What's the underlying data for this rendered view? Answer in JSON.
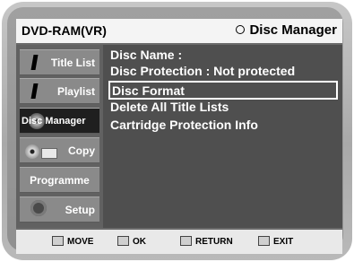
{
  "header": {
    "mode": "DVD-RAM(VR)",
    "title": "Disc Manager"
  },
  "sidebar": {
    "items": [
      {
        "label": "Title List",
        "icon": "disc-icon"
      },
      {
        "label": "Playlist",
        "icon": "disc-icon"
      },
      {
        "label": "Disc Manager",
        "icon": "disc-icon"
      },
      {
        "label": "Copy",
        "icon": "copy-icon"
      },
      {
        "label": "Programme",
        "icon": ""
      },
      {
        "label": "Setup",
        "icon": "gear-icon"
      }
    ],
    "active_index": 2
  },
  "menu": {
    "items": [
      "Disc Name       :",
      "Disc Protection : Not protected",
      "Disc Format",
      "Delete All Title Lists",
      "Cartridge Protection Info"
    ],
    "selected_index": 2
  },
  "footer": {
    "move": "MOVE",
    "ok": "OK",
    "return": "RETURN",
    "exit": "EXIT"
  }
}
